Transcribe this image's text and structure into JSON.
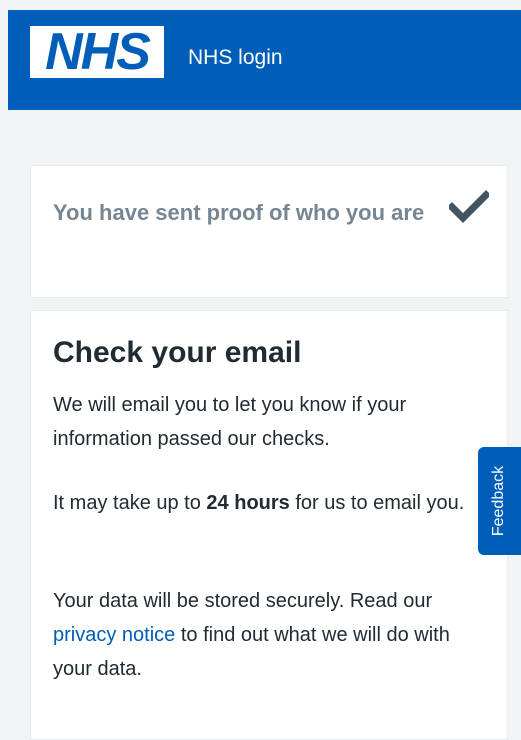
{
  "header": {
    "logo_text": "NHS",
    "service_name": "NHS login"
  },
  "status_panel": {
    "message": "You have sent proof of who you are",
    "icon": "tick-icon"
  },
  "main_panel": {
    "heading": "Check your email",
    "para1": "We will email you to let you know if your information passed our checks.",
    "para2_before": "It may take up to ",
    "para2_bold": "24 hours",
    "para2_after": " for us to email you.",
    "para3_before": "Your data will be stored securely. Read our ",
    "para3_link": "privacy notice",
    "para3_after": " to find out what we will do with your data."
  },
  "feedback": {
    "label": "Feedback"
  },
  "colors": {
    "brand_blue": "#005eb8",
    "page_bg": "#f0f4f5",
    "text": "#212b32",
    "muted": "#768692"
  }
}
